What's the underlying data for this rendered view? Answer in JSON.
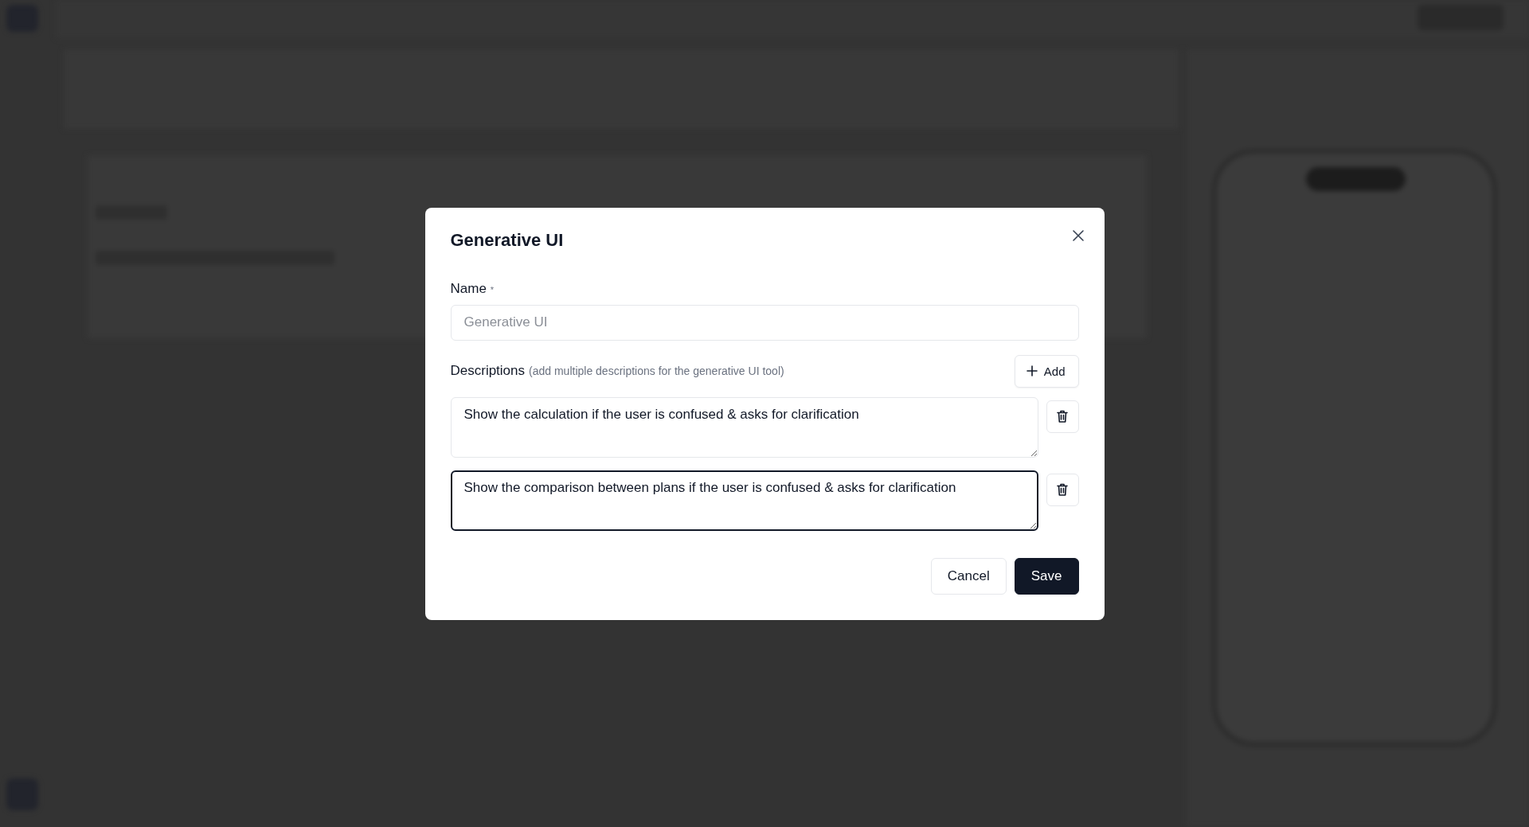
{
  "dialog": {
    "title": "Generative UI",
    "name_field": {
      "label": "Name",
      "required_mark": "*",
      "placeholder": "Generative UI"
    },
    "descriptions": {
      "label": "Descriptions",
      "hint": "(add multiple descriptions for the generative UI tool)",
      "add_button": "Add",
      "items": [
        {
          "value": "Show the calculation if the user is confused & asks for clarification",
          "focused": false
        },
        {
          "value": "Show the comparison between plans if the user is confused & asks for clarification",
          "focused": true
        }
      ]
    },
    "buttons": [
      {
        "label": "Cancel",
        "kind": "secondary"
      },
      {
        "label": "Save",
        "kind": "primary"
      }
    ]
  }
}
